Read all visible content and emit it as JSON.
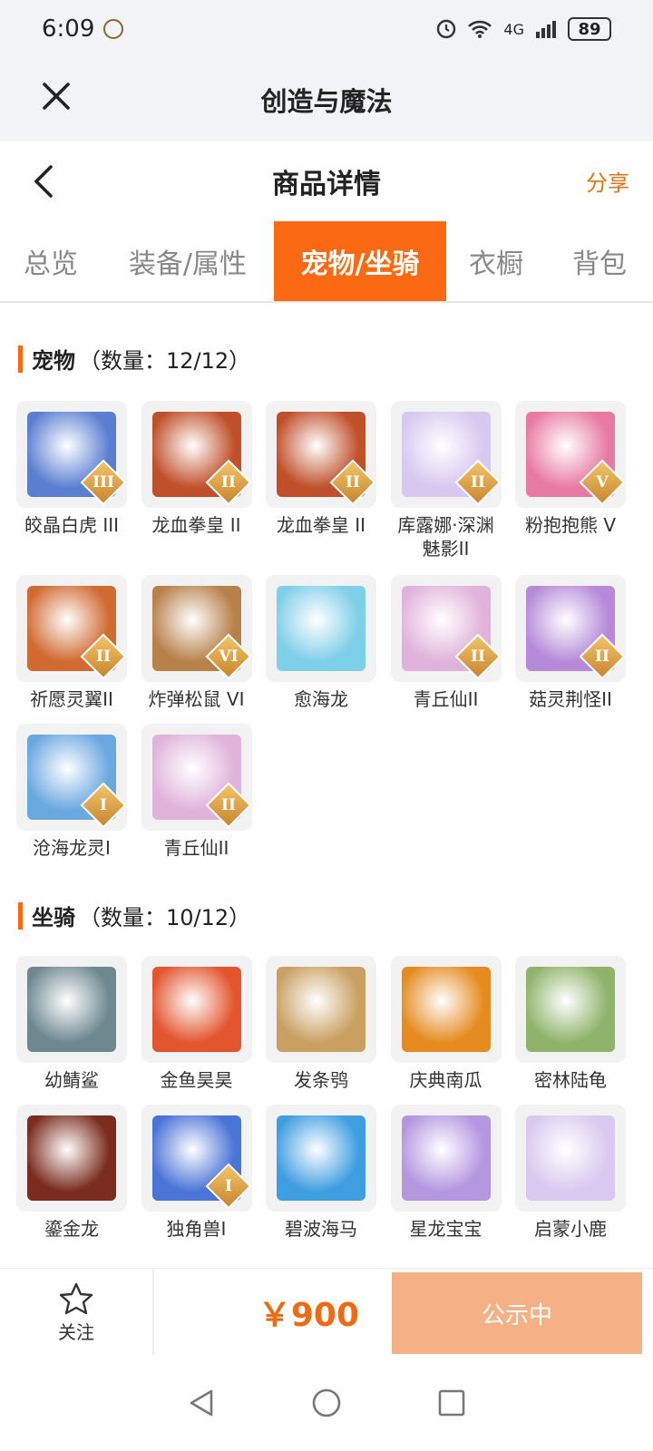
{
  "status": {
    "time": "6:09",
    "network": "4G",
    "battery": "89"
  },
  "app": {
    "title": "创造与魔法"
  },
  "page": {
    "title": "商品详情",
    "share": "分享"
  },
  "tabs": [
    {
      "label": "总览",
      "active": false
    },
    {
      "label": "装备/属性",
      "active": false
    },
    {
      "label": "宠物/坐骑",
      "active": true
    },
    {
      "label": "衣橱",
      "active": false
    },
    {
      "label": "背包",
      "active": false
    }
  ],
  "pets": {
    "title": "宠物",
    "count": "（数量：12/12）",
    "items": [
      {
        "name": "皎晶白虎 III",
        "badge": "III",
        "color": "#5b7fd0"
      },
      {
        "name": "龙血拳皇 II",
        "badge": "II",
        "color": "#c0502a"
      },
      {
        "name": "龙血拳皇 II",
        "badge": "II",
        "color": "#c0502a"
      },
      {
        "name": "库露娜·深渊魅影II",
        "badge": "II",
        "color": "#d7c8f0"
      },
      {
        "name": "粉抱抱熊 V",
        "badge": "V",
        "color": "#e77aa0"
      },
      {
        "name": "祈愿灵翼II",
        "badge": "II",
        "color": "#d06a30"
      },
      {
        "name": "炸弹松鼠 VI",
        "badge": "VI",
        "color": "#b7814a"
      },
      {
        "name": "愈海龙",
        "badge": "",
        "color": "#7ecfe8"
      },
      {
        "name": "青丘仙II",
        "badge": "II",
        "color": "#e0b3da"
      },
      {
        "name": "菇灵荆怪II",
        "badge": "II",
        "color": "#b68ad8"
      },
      {
        "name": "沧海龙灵I",
        "badge": "I",
        "color": "#6aa8e0"
      },
      {
        "name": "青丘仙II",
        "badge": "II",
        "color": "#e0b3da"
      }
    ]
  },
  "mounts": {
    "title": "坐骑",
    "count": "（数量：10/12）",
    "items": [
      {
        "name": "幼鲭鲨",
        "badge": "",
        "color": "#6e8890"
      },
      {
        "name": "金鱼昊昊",
        "badge": "",
        "color": "#e2552d"
      },
      {
        "name": "发条鸮",
        "badge": "",
        "color": "#c9a061"
      },
      {
        "name": "庆典南瓜",
        "badge": "",
        "color": "#e58b20"
      },
      {
        "name": "密林陆龟",
        "badge": "",
        "color": "#8fb36a"
      },
      {
        "name": "鎏金龙",
        "badge": "",
        "color": "#7a2d1e"
      },
      {
        "name": "独角兽I",
        "badge": "I",
        "color": "#4a74d6"
      },
      {
        "name": "碧波海马",
        "badge": "",
        "color": "#3f9ee0"
      },
      {
        "name": "星龙宝宝",
        "badge": "",
        "color": "#b597e0"
      },
      {
        "name": "启蒙小鹿",
        "badge": "",
        "color": "#d9c9ef"
      }
    ]
  },
  "bottom": {
    "follow": "关注",
    "price": "￥900",
    "status": "公示中"
  }
}
